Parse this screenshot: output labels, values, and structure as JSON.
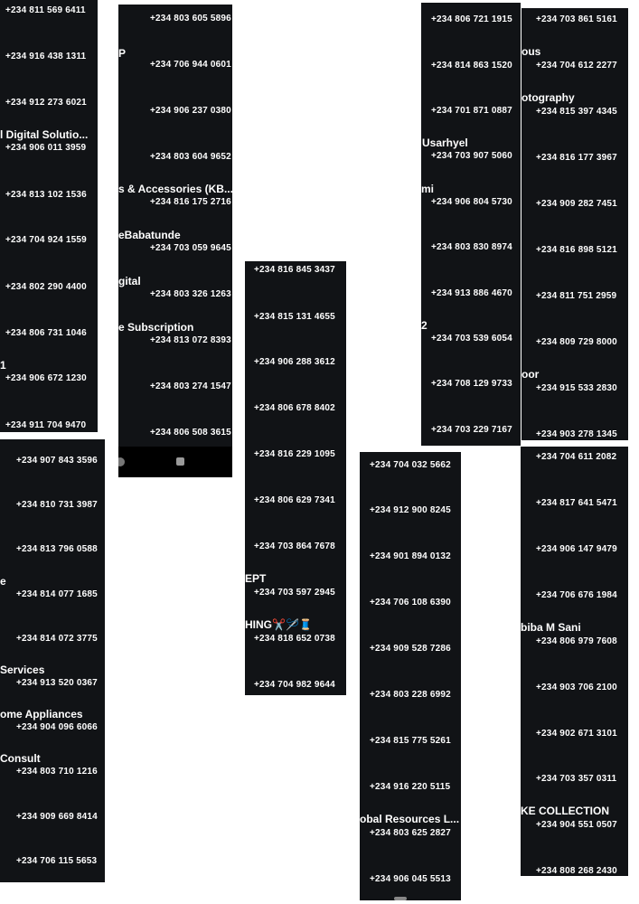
{
  "strips": [
    {
      "id": "s1",
      "contacts": [
        {
          "name": "",
          "phone": "+234 811 569 6411"
        },
        {
          "name": "",
          "phone": "+234 916 438 1311"
        },
        {
          "name": "",
          "phone": "+234 912 273 6021"
        },
        {
          "name": "l Digital Solutio...",
          "phone": "+234 906 011 3959"
        },
        {
          "name": "",
          "phone": "+234 813 102 1536"
        },
        {
          "name": "",
          "phone": "+234 704 924 1559"
        },
        {
          "name": "",
          "phone": "+234 802 290 4400"
        },
        {
          "name": "",
          "phone": "+234 806 731 1046"
        },
        {
          "name": "1",
          "phone": "+234 906 672 1230"
        },
        {
          "name": "",
          "phone": "+234 911 704 9470"
        }
      ]
    },
    {
      "id": "s2",
      "contacts": [
        {
          "name": "",
          "phone": "+234 803 605 5896"
        },
        {
          "name": "P",
          "phone": "+234 706 944 0601"
        },
        {
          "name": "",
          "phone": "+234 906 237 0380"
        },
        {
          "name": "",
          "phone": "+234 803 604 9652"
        },
        {
          "name": "s & Accessories (KB...",
          "phone": "+234 816 175 2716"
        },
        {
          "name": "eBabatunde",
          "phone": "+234 703 059 9645"
        },
        {
          "name": "gital",
          "phone": "+234 803 326 1263"
        },
        {
          "name": "e Subscription",
          "phone": "+234 813 072 8393"
        },
        {
          "name": "",
          "phone": "+234 803 274 1547"
        },
        {
          "name": "",
          "phone": "+234 806 508 3615"
        }
      ]
    },
    {
      "id": "s3",
      "contacts": [
        {
          "name": "",
          "phone": "+234 907 843 3596"
        },
        {
          "name": "",
          "phone": "+234 810 731 3987"
        },
        {
          "name": "",
          "phone": "+234 813 796 0588"
        },
        {
          "name": "e",
          "phone": "+234 814 077 1685"
        },
        {
          "name": "",
          "phone": "+234 814 072 3775"
        },
        {
          "name": "Services",
          "phone": "+234 913 520 0367"
        },
        {
          "name": "ome Appliances",
          "phone": "+234 904 096 6066"
        },
        {
          "name": "Consult",
          "phone": "+234 803 710 1216"
        },
        {
          "name": "",
          "phone": "+234 909 669 8414"
        },
        {
          "name": "",
          "phone": "+234 706 115 5653"
        }
      ]
    },
    {
      "id": "s4",
      "contacts": [
        {
          "name": "",
          "phone": "+234 816 845 3437"
        },
        {
          "name": "",
          "phone": "+234 815 131 4655"
        },
        {
          "name": "",
          "phone": "+234 906 288 3612"
        },
        {
          "name": "",
          "phone": "+234 806 678 8402"
        },
        {
          "name": "",
          "phone": "+234 816 229 1095"
        },
        {
          "name": "",
          "phone": "+234 806 629 7341"
        },
        {
          "name": "",
          "phone": "+234 703 864 7678"
        },
        {
          "name": "EPT",
          "phone": "+234 703 597 2945"
        },
        {
          "name": "HING✂️🪡🧵",
          "phone": "+234 818 652 0738"
        },
        {
          "name": "",
          "phone": "+234 704 982 9644"
        }
      ]
    },
    {
      "id": "s5",
      "contacts": [
        {
          "name": "",
          "phone": "+234 704 032 5662"
        },
        {
          "name": "",
          "phone": "+234 912 900 8245"
        },
        {
          "name": "",
          "phone": "+234 901 894 0132"
        },
        {
          "name": "",
          "phone": "+234 706 108 6390"
        },
        {
          "name": "",
          "phone": "+234 909 528 7286"
        },
        {
          "name": "",
          "phone": "+234 803 228 6992"
        },
        {
          "name": "",
          "phone": "+234 815 775 5261"
        },
        {
          "name": "",
          "phone": "+234 916 220 5115"
        },
        {
          "name": "obal Resources L...",
          "phone": "+234 803 625 2827"
        },
        {
          "name": "",
          "phone": "+234 906 045 5513"
        }
      ]
    },
    {
      "id": "s6",
      "contacts": [
        {
          "name": "",
          "phone": "+234 806 721 1915"
        },
        {
          "name": "",
          "phone": "+234 814 863 1520"
        },
        {
          "name": "",
          "phone": "+234 701 871 0887"
        },
        {
          "name": "Usarhyel",
          "phone": "+234 703 907 5060"
        },
        {
          "name": "mi",
          "phone": "+234 906 804 5730"
        },
        {
          "name": "",
          "phone": "+234 803 830 8974"
        },
        {
          "name": "",
          "phone": "+234 913 886 4670"
        },
        {
          "name": "2",
          "phone": "+234 703 539 6054"
        },
        {
          "name": "",
          "phone": "+234 708 129 9733"
        },
        {
          "name": "",
          "phone": "+234 703 229 7167"
        }
      ]
    },
    {
      "id": "s7",
      "contacts": [
        {
          "name": "",
          "phone": "+234 703 861 5161"
        },
        {
          "name": "ous",
          "phone": "+234 704 612 2277"
        },
        {
          "name": "otography",
          "phone": "+234 815 397 4345"
        },
        {
          "name": "",
          "phone": "+234 816 177 3967"
        },
        {
          "name": "",
          "phone": "+234 909 282 7451"
        },
        {
          "name": "",
          "phone": "+234 816 898 5121"
        },
        {
          "name": "",
          "phone": "+234 811 751 2959"
        },
        {
          "name": "",
          "phone": "+234 809 729 8000"
        },
        {
          "name": "oor",
          "phone": "+234 915 533 2830"
        },
        {
          "name": "",
          "phone": "+234 903 278 1345"
        }
      ]
    },
    {
      "id": "s8",
      "contacts": [
        {
          "name": "",
          "phone": "+234 704 611 2082"
        },
        {
          "name": "",
          "phone": "+234 817 641 5471"
        },
        {
          "name": "",
          "phone": "+234 906 147 9479"
        },
        {
          "name": "",
          "phone": "+234 706 676 1984"
        },
        {
          "name": "biba M Sani",
          "phone": "+234 806 979 7608"
        },
        {
          "name": "",
          "phone": "+234 903 706 2100"
        },
        {
          "name": "",
          "phone": "+234 902 671 3101"
        },
        {
          "name": "",
          "phone": "+234 703 357 0311"
        },
        {
          "name": "KE COLLECTION",
          "phone": "+234 904 551 0507"
        },
        {
          "name": "",
          "phone": "+234 808 268 2430"
        }
      ]
    }
  ]
}
